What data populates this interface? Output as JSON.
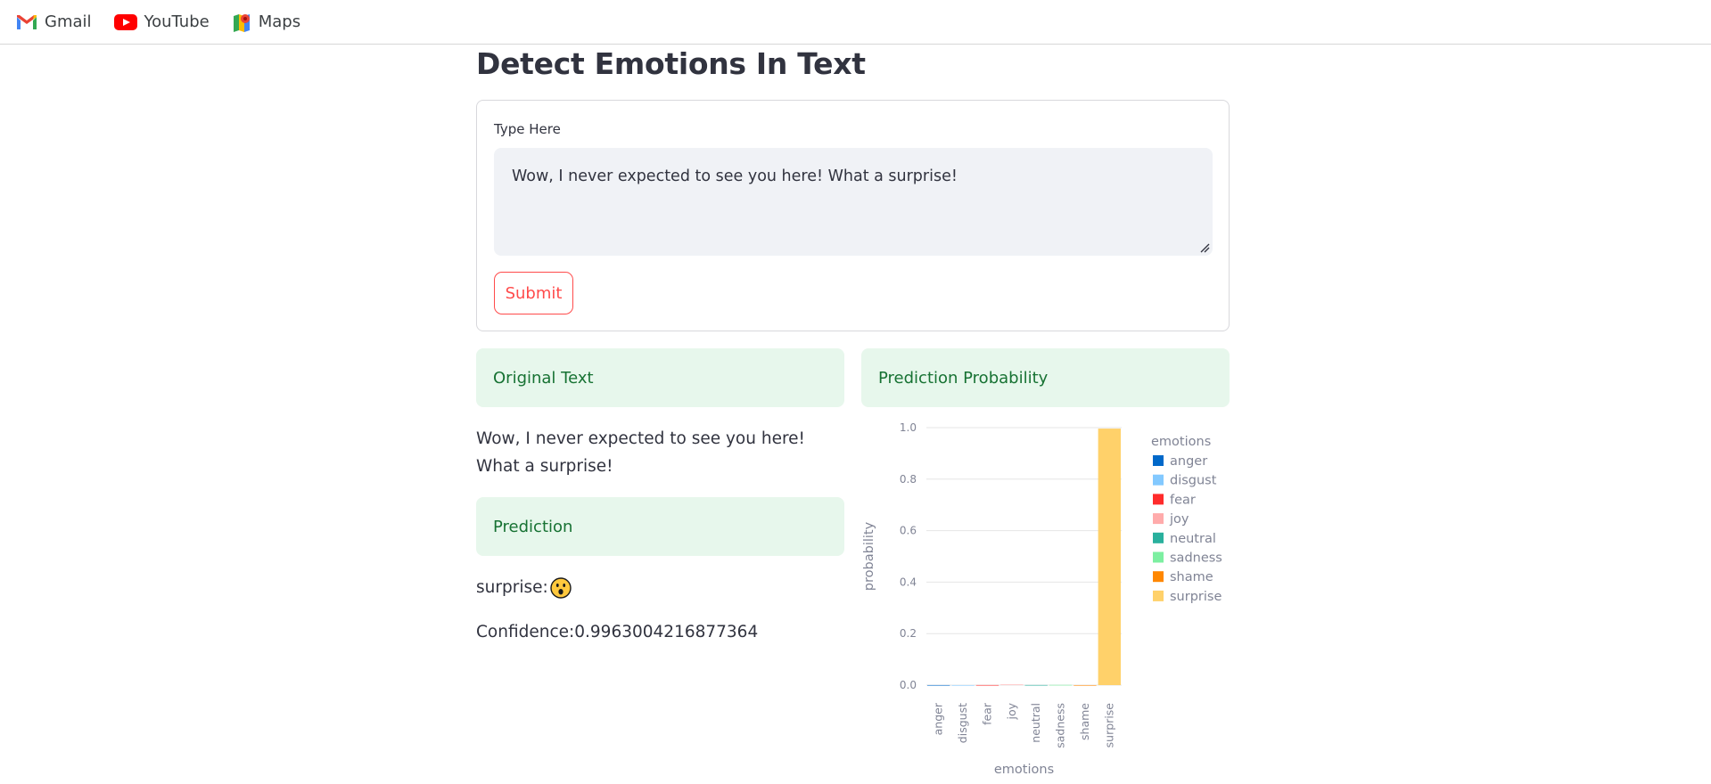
{
  "bookmarks": [
    {
      "label": "Gmail",
      "icon": "gmail-icon"
    },
    {
      "label": "YouTube",
      "icon": "youtube-icon"
    },
    {
      "label": "Maps",
      "icon": "maps-icon"
    }
  ],
  "page": {
    "title": "Detect Emotions In Text"
  },
  "form": {
    "label": "Type Here",
    "value": "Wow, I never expected to see you here! What a surprise!",
    "submit_label": "Submit"
  },
  "results": {
    "original_header": "Original Text",
    "original_text": "Wow, I never expected to see you here! What a surprise!",
    "prediction_header": "Prediction",
    "prediction_label": "surprise:",
    "prediction_emoji": "surprised-face-emoji",
    "confidence_text": "Confidence:0.9963004216877364",
    "probability_header": "Prediction Probability"
  },
  "colors": {
    "accent": "#ff4b4b",
    "info_bg": "#e7f7ec",
    "info_text": "#177233",
    "input_bg": "#f0f2f6"
  },
  "chart_data": {
    "type": "bar",
    "xlabel": "emotions",
    "ylabel": "probability",
    "categories": [
      "anger",
      "disgust",
      "fear",
      "joy",
      "neutral",
      "sadness",
      "shame",
      "surprise"
    ],
    "values": [
      0.0002,
      0.0001,
      0.0003,
      0.0021,
      0.0004,
      0.0008,
      0.0001,
      0.9963
    ],
    "colors": [
      "#0068c9",
      "#83c9ff",
      "#ff2b2b",
      "#ffabab",
      "#29b09d",
      "#7defa1",
      "#ff8700",
      "#ffd16a"
    ],
    "ylim": [
      0,
      1.0
    ],
    "yticks": [
      "0.0",
      "0.2",
      "0.4",
      "0.6",
      "0.8",
      "1.0"
    ],
    "legend_title": "emotions",
    "legend_position": "right",
    "grid": true
  }
}
